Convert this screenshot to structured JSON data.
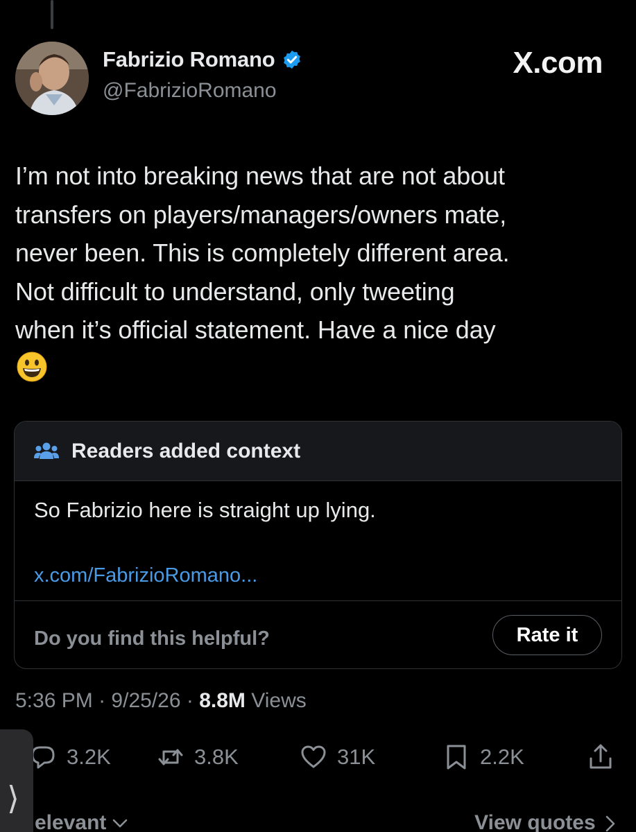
{
  "author": {
    "display_name": "Fabrizio Romano",
    "handle": "@FabrizioRomano",
    "verified": true
  },
  "brand": "X.com",
  "tweet": {
    "lines": [
      "I’m not into breaking news that are not about",
      "transfers on players/managers/owners mate,",
      "never been. This is completely different area.",
      "Not difficult to understand, only tweeting",
      "when it’s official statement. Have a nice day"
    ],
    "emoji": "grinning-face-emoji"
  },
  "community_note": {
    "title": "Readers added context",
    "body": "So Fabrizio here is straight up lying.",
    "link": "x.com/FabrizioRomano...",
    "helpful_question": "Do you find this helpful?",
    "rate_label": "Rate it"
  },
  "meta": {
    "time": "5:36 PM",
    "separator": "·",
    "date": "9/25/26",
    "views_count": "8.8M",
    "views_label": "Views"
  },
  "actions": {
    "replies": "3.2K",
    "reposts": "3.8K",
    "likes": "31K",
    "bookmarks": "2.2K"
  },
  "bottom": {
    "sort_label": "elevant",
    "view_quotes": "View quotes"
  },
  "colors": {
    "background": "#000000",
    "text": "#e7e9ea",
    "muted": "#8b9096",
    "link": "#4a9be6",
    "verified": "#1d9bf0",
    "border": "#2f3336"
  }
}
